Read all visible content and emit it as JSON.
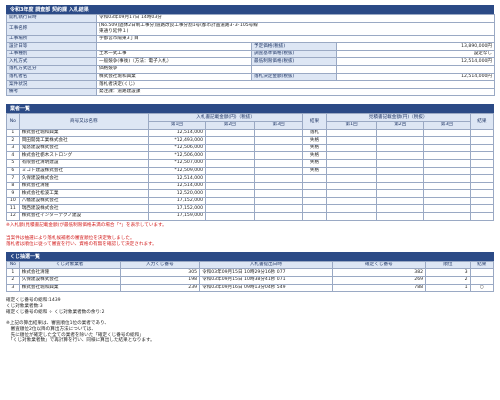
{
  "header": {
    "title": "令和3年度 調査部 契約課 入札結果"
  },
  "info": {
    "rows": [
      {
        "label": "開札執行日時",
        "value": "令和03年09月17日 14時03分"
      },
      {
        "label": "工事名称",
        "value": "[No.509]過休2日制工事分]道路改良工事分割1号(都市計画道路3･3･105号線<br>東通り延伸１)"
      },
      {
        "label": "工事場所",
        "value": "宇都宮市陽東3丁目"
      },
      {
        "label": "設計日等",
        "value": "",
        "label2": "予定価格(税抜)",
        "value2": "13,890,000円"
      },
      {
        "label": "工事種別",
        "value": "土木一式工事",
        "label2": "調査基準価格(税抜)",
        "value2": "設定なし"
      },
      {
        "label": "入札方式",
        "value": "一般競争(事後)（方法：電子入札）",
        "label2": "最低制限価格(税抜)",
        "value2": "12,514,000円"
      },
      {
        "label": "落札方式区分",
        "value": "価格競争",
        "label2": "",
        "value2": ""
      },
      {
        "label": "落札者名",
        "value": "株式会社堀和興業",
        "label2": "落札決定金額(税抜)",
        "value2": "12,514,000円"
      },
      {
        "label": "案件状況",
        "value": "落札者決定(くじ)"
      },
      {
        "label": "備考",
        "value": "発注課：道路建設課"
      }
    ]
  },
  "bidders": {
    "section_title": "業者一覧",
    "headers": {
      "no": "No",
      "name": "商号又は名称",
      "amount_group": "入札書記載金額(円)（税抜）",
      "round1": "第1回",
      "round2": "第2回",
      "round3": "第3回",
      "result": "結果",
      "lowest_group": "見積書記載金額(円)（税抜）",
      "l1": "第1回",
      "l2": "第2回",
      "l3": "第3回",
      "result2": "結果"
    },
    "rows": [
      {
        "no": "1",
        "name": "株式会社堀和興業",
        "r1": "12,514,000",
        "result": "落札"
      },
      {
        "no": "2",
        "name": "岡田開発工業株式会社",
        "r1": "*12,493,000",
        "result": "失格"
      },
      {
        "no": "3",
        "name": "鬼怒建設株式会社",
        "r1": "*12,506,000",
        "result": "失格"
      },
      {
        "no": "4",
        "name": "株式会社栃木ストロング",
        "r1": "*12,506,000",
        "result": "失格"
      },
      {
        "no": "5",
        "name": "有限会社清明建設",
        "r1": "*12,507,000",
        "result": "失格"
      },
      {
        "no": "6",
        "name": "ミコト建設株式会社",
        "r1": "*12,509,000",
        "result": "失格"
      },
      {
        "no": "7",
        "name": "久保建設株式会社",
        "r1": "12,514,000",
        "result": ""
      },
      {
        "no": "8",
        "name": "株式会社清隆",
        "r1": "12,514,000",
        "result": ""
      },
      {
        "no": "9",
        "name": "株式会社松波工業",
        "r1": "12,520,000",
        "result": ""
      },
      {
        "no": "10",
        "name": "八幡建設株式会社",
        "r1": "17,152,000",
        "result": ""
      },
      {
        "no": "11",
        "name": "瑞西建設株式会社",
        "r1": "17,152,000",
        "result": ""
      },
      {
        "no": "12",
        "name": "株式会社インターテクノ建設",
        "r1": "17,159,000",
        "result": ""
      }
    ],
    "note": "※入札額(見積書記載金額)が最低制限価格未満の場合「*」を表示しています。"
  },
  "lottery_notice": {
    "line1": "当案件は抽選により落札候補者の審査順位を決定致しました。",
    "line2": "落札者は順位に従って審査を行い、資格の有無を確認して決定されます。"
  },
  "lottery": {
    "section_title": "くじ抽選一覧",
    "headers": {
      "no": "No",
      "name": "くじ対象業者",
      "number": "入力くじ番号",
      "datetime": "入札書提出日時",
      "final": "確定くじ番号",
      "order": "順位",
      "result": "結果"
    },
    "rows": [
      {
        "no": "1",
        "name": "株式会社清隆",
        "number": "305",
        "datetime": "令和03年09月15日 10時29分16秒 077",
        "final": "382",
        "order": "3",
        "result": ""
      },
      {
        "no": "2",
        "name": "久保建設株式会社",
        "number": "198",
        "datetime": "令和03年09月15日 10時38分41秒 071",
        "final": "269",
        "order": "2",
        "result": ""
      },
      {
        "no": "3",
        "name": "株式会社堀和興業",
        "number": "239",
        "datetime": "令和03年09月16日 09時13分04秒 549",
        "final": "788",
        "order": "1",
        "result": "○"
      }
    ]
  },
  "footer": {
    "lines": [
      "確定くじ番号の総和:1439",
      "くじ対象業者数:3",
      "確定くじ番号の総和 ÷ くじ対象業者数の余り:2",
      "",
      "※上記の算出結果は、審査順位1位の業者であり、",
      "　審査順位2位以降の算出方法については、",
      "　先に順位が確定した全ての業者を除いた「確定くじ番号の総和」",
      "　「くじ対象業者数」で再計算を行い、同様に算出した結果となります。"
    ]
  }
}
